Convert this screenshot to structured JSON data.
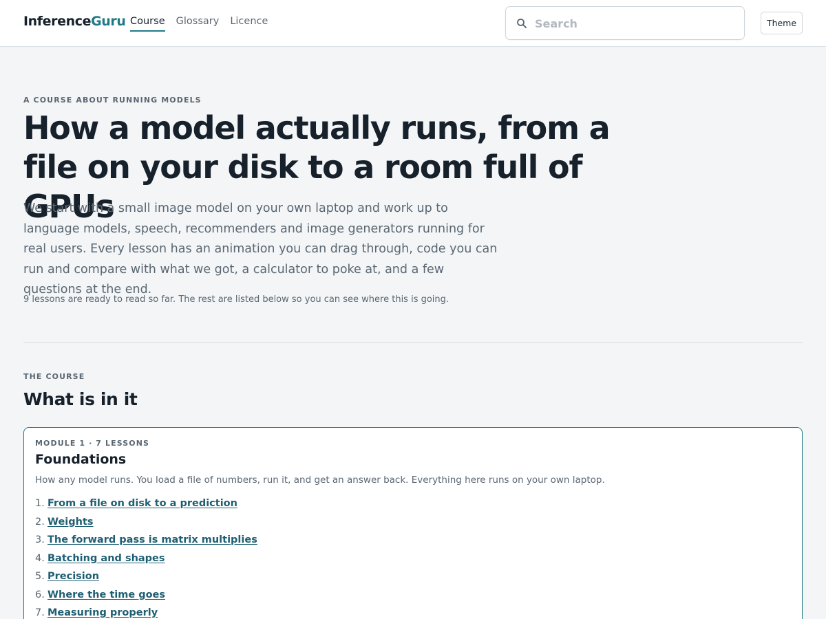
{
  "header": {
    "logo_main": "Inference",
    "logo_accent": "Guru",
    "nav": [
      {
        "label": "Course",
        "active": true
      },
      {
        "label": "Glossary",
        "active": false
      },
      {
        "label": "Licence",
        "active": false
      }
    ],
    "search": {
      "placeholder": "Search",
      "value": "",
      "icon": "search-icon"
    },
    "theme_label": "Theme"
  },
  "hero": {
    "eyebrow": "A COURSE ABOUT RUNNING MODELS",
    "title": "How a model actually runs, from a file on your disk to a room full of GPUs",
    "lead": "We start with a small image model on your own laptop and work up to language models, speech, recommenders and image generators running for real users. Every lesson has an animation you can drag through, code you can run and compare with what we got, a calculator to poke at, and a few questions at the end.",
    "note": "9 lessons are ready to read so far. The rest are listed below so you can see where this is going."
  },
  "course": {
    "eyebrow": "THE COURSE",
    "title": "What is in it",
    "modules": [
      {
        "meta": "MODULE 1 · 7 LESSONS",
        "title": "Foundations",
        "description": "How any model runs. You load a file of numbers, run it, and get an answer back. Everything here runs on your own laptop.",
        "lessons": [
          {
            "num": "1.",
            "label": "From a file on disk to a prediction"
          },
          {
            "num": "2.",
            "label": "Weights"
          },
          {
            "num": "3.",
            "label": "The forward pass is matrix multiplies"
          },
          {
            "num": "4.",
            "label": "Batching and shapes"
          },
          {
            "num": "5.",
            "label": "Precision"
          },
          {
            "num": "6.",
            "label": "Where the time goes"
          },
          {
            "num": "7.",
            "label": "Measuring properly"
          }
        ]
      }
    ]
  },
  "colors": {
    "accent": "#1f7a86",
    "link": "#1f5f73",
    "text": "#17212b",
    "muted": "#5a6772",
    "background": "#f3f5f7"
  }
}
